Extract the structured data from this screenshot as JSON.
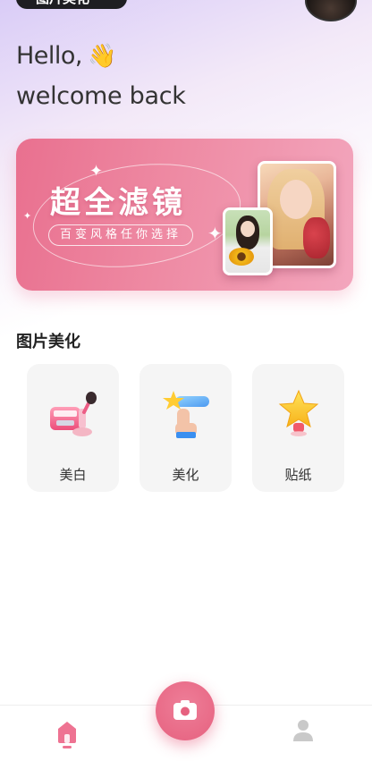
{
  "status": {
    "pill_text": "图片美化"
  },
  "greeting": {
    "line1": "Hello,",
    "wave": "👋",
    "line2": "welcome back"
  },
  "banner": {
    "title": "超全滤镜",
    "subtitle": "百变风格任你选择"
  },
  "section": {
    "title": "图片美化"
  },
  "tools": [
    {
      "label": "美白",
      "icon": "makeup-kit-icon"
    },
    {
      "label": "美化",
      "icon": "touch-star-icon"
    },
    {
      "label": "贴纸",
      "icon": "star-sticker-icon"
    }
  ],
  "nav": {
    "left": "home-icon",
    "center": "camera-icon",
    "right": "user-icon"
  },
  "colors": {
    "accent": "#e6617f",
    "banner_start": "#e9708f",
    "banner_end": "#f3a6bd",
    "tile_bg": "#f5f5f5"
  }
}
